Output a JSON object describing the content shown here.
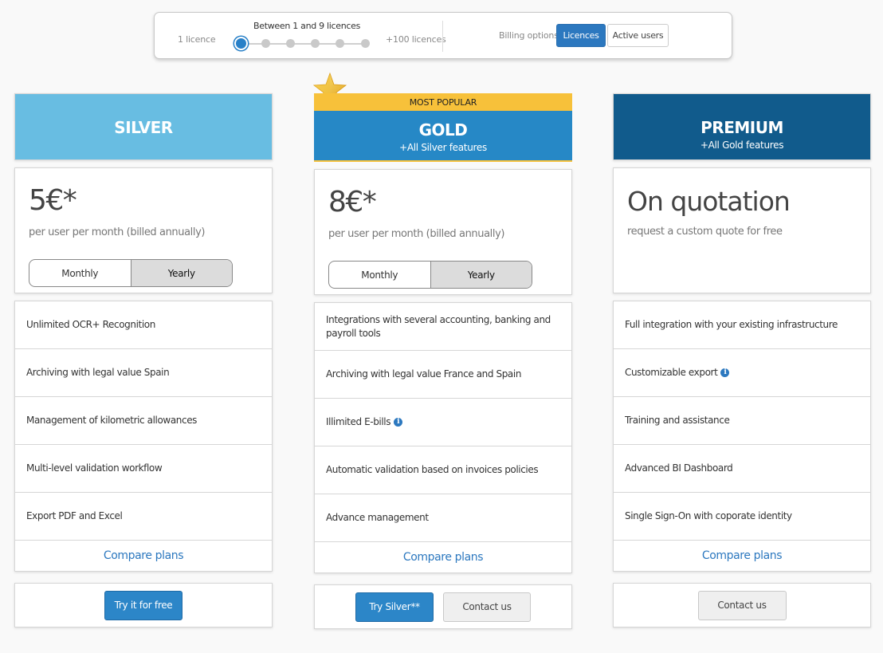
{
  "selector": {
    "title": "Between 1 and 9 licences",
    "min_label": "1 licence",
    "max_label": "+100 licences",
    "steps": 6,
    "selected_step": 0,
    "billing_label": "Billing options:",
    "billing_options": [
      {
        "label": "Licences",
        "active": true
      },
      {
        "label": "Active users",
        "active": false
      }
    ]
  },
  "colors": {
    "silver": "#68bde2",
    "gold": "#2688c6",
    "premium": "#115b8c",
    "popular": "#f7c13a",
    "accent": "#2c78bf"
  },
  "plans": {
    "silver": {
      "name": "SILVER",
      "price": "5€*",
      "price_note": "per user per month (billed annually)",
      "period_options": [
        "Monthly",
        "Yearly"
      ],
      "selected_period": "Yearly",
      "features": [
        {
          "text": "Unlimited OCR+ Recognition"
        },
        {
          "text": "Archiving with legal value Spain"
        },
        {
          "text": "Management of kilometric allowances"
        },
        {
          "text": "Multi-level validation workflow"
        },
        {
          "text": "Export PDF and Excel"
        }
      ],
      "compare_label": "Compare plans",
      "cta_primary": "Try it for free"
    },
    "gold": {
      "badge": "MOST POPULAR",
      "name": "GOLD",
      "subtitle": "+All Silver features",
      "price": "8€*",
      "price_note": "per user per month (billed annually)",
      "period_options": [
        "Monthly",
        "Yearly"
      ],
      "selected_period": "Yearly",
      "features": [
        {
          "text": "Integrations with several accounting, banking and payroll tools"
        },
        {
          "text": "Archiving with legal value France and Spain"
        },
        {
          "text": "Illimited E-bills",
          "info": true
        },
        {
          "text": "Automatic validation based on invoices policies"
        },
        {
          "text": "Advance management"
        }
      ],
      "compare_label": "Compare plans",
      "cta_primary": "Try Silver**",
      "cta_secondary": "Contact us"
    },
    "premium": {
      "name": "PREMIUM",
      "subtitle": "+All Gold features",
      "price": "On quotation",
      "price_note": "request a custom quote for free",
      "features": [
        {
          "text": "Full integration with your existing infrastructure"
        },
        {
          "text": "Customizable export",
          "info": true
        },
        {
          "text": "Training and assistance"
        },
        {
          "text": "Advanced BI Dashboard"
        },
        {
          "text": "Single Sign-On with coporate identity"
        }
      ],
      "compare_label": "Compare plans",
      "cta_secondary": "Contact us"
    }
  },
  "icons": {
    "info": "i",
    "star": "star-icon"
  }
}
